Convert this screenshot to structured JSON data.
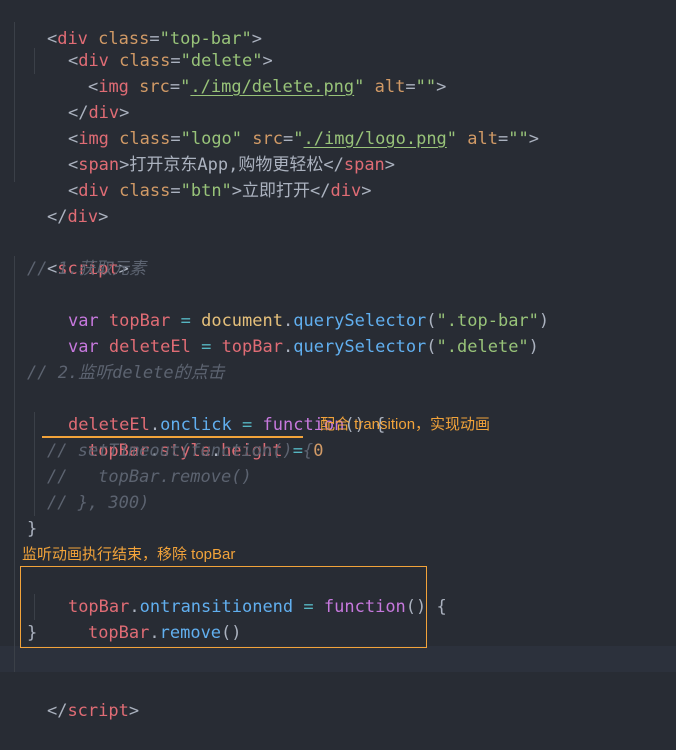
{
  "code": {
    "l1": [
      "<",
      "div",
      " ",
      "class",
      "=",
      "\"top-bar\"",
      ">"
    ],
    "l2": [
      "<",
      "div",
      " ",
      "class",
      "=",
      "\"delete\"",
      ">"
    ],
    "l3": [
      "<",
      "img",
      " ",
      "src",
      "=",
      "\"",
      "./img/delete.png",
      "\"",
      " ",
      "alt",
      "=",
      "\"\"",
      ">"
    ],
    "l4": [
      "</",
      "div",
      ">"
    ],
    "l5": [
      "<",
      "img",
      " ",
      "class",
      "=",
      "\"logo\"",
      " ",
      "src",
      "=",
      "\"",
      "./img/logo.png",
      "\"",
      " ",
      "alt",
      "=",
      "\"\"",
      ">"
    ],
    "l6": [
      "<",
      "span",
      ">",
      "打开京东App,购物更轻松",
      "</",
      "span",
      ">"
    ],
    "l7": [
      "<",
      "div",
      " ",
      "class",
      "=",
      "\"btn\"",
      ">",
      "立即打开",
      "</",
      "div",
      ">"
    ],
    "l8": [
      "</",
      "div",
      ">"
    ],
    "l10": [
      "<",
      "script",
      ">"
    ],
    "l11": "// 1.获取元素",
    "l12": [
      "var",
      " ",
      "topBar",
      " ",
      "=",
      " ",
      "document",
      ".",
      "querySelector",
      "(",
      "\".top-bar\"",
      ")"
    ],
    "l13": [
      "var",
      " ",
      "deleteEl",
      " ",
      "=",
      " ",
      "topBar",
      ".",
      "querySelector",
      "(",
      "\".delete\"",
      ")"
    ],
    "l15": "// 2.监听delete的点击",
    "l16": [
      "deleteEl",
      ".",
      "onclick",
      " ",
      "=",
      " ",
      "function",
      "()",
      " ",
      "{"
    ],
    "l17": [
      "topBar",
      ".",
      "style",
      ".",
      "height",
      " ",
      "=",
      " ",
      "0"
    ],
    "l18": "// setTimeout(function() {",
    "l19": "//   topBar.remove()",
    "l20": "// }, 300)",
    "l21": "}",
    "l23": [
      "topBar",
      ".",
      "ontransitionend",
      " ",
      "=",
      " ",
      "function",
      "()",
      " ",
      "{"
    ],
    "l24": [
      "topBar",
      ".",
      "remove",
      "()"
    ],
    "l25": "}",
    "l27": [
      "</",
      "script",
      ">"
    ]
  },
  "annotations": {
    "transition_note": "配合 transition，实现动画",
    "end_note": "监听动画执行结束，移除 topBar"
  }
}
